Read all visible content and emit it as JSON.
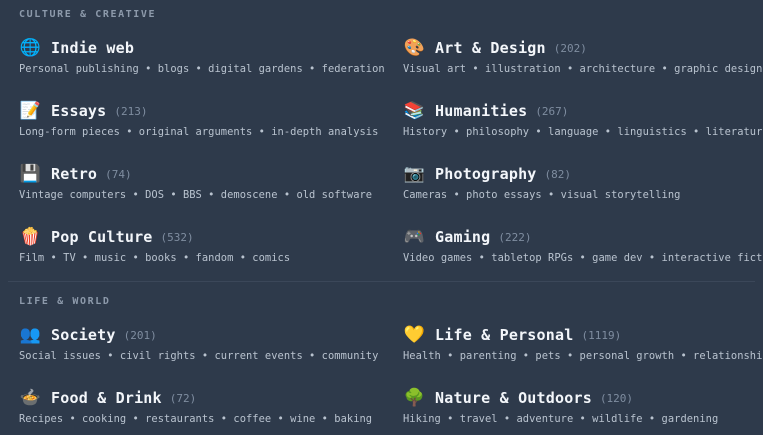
{
  "sections": [
    {
      "title": "CULTURE & CREATIVE",
      "items": [
        {
          "icon": "globe-icon",
          "glyph": "🌐",
          "name": "Indie web",
          "count": "",
          "desc": "Personal publishing • blogs • digital gardens • federation"
        },
        {
          "icon": "palette-icon",
          "glyph": "🎨",
          "name": "Art & Design",
          "count": "(202)",
          "desc": "Visual art • illustration • architecture • graphic design"
        },
        {
          "icon": "memo-icon",
          "glyph": "📝",
          "name": "Essays",
          "count": "(213)",
          "desc": "Long-form pieces • original arguments • in-depth analysis"
        },
        {
          "icon": "books-icon",
          "glyph": "📚",
          "name": "Humanities",
          "count": "(267)",
          "desc": "History • philosophy • language • linguistics • literature"
        },
        {
          "icon": "floppy-disk-icon",
          "glyph": "💾",
          "name": "Retro",
          "count": "(74)",
          "desc": "Vintage computers • DOS • BBS • demoscene • old software"
        },
        {
          "icon": "camera-icon",
          "glyph": "📷",
          "name": "Photography",
          "count": "(82)",
          "desc": "Cameras • photo essays • visual storytelling"
        },
        {
          "icon": "popcorn-icon",
          "glyph": "🍿",
          "name": "Pop Culture",
          "count": "(532)",
          "desc": "Film • TV • music • books • fandom • comics"
        },
        {
          "icon": "gamepad-icon",
          "glyph": "🎮",
          "name": "Gaming",
          "count": "(222)",
          "desc": "Video games • tabletop RPGs • game dev • interactive fiction"
        }
      ]
    },
    {
      "title": "LIFE & WORLD",
      "items": [
        {
          "icon": "people-icon",
          "glyph": "👥",
          "name": "Society",
          "count": "(201)",
          "desc": "Social issues • civil rights • current events • community"
        },
        {
          "icon": "yellow-heart-icon",
          "glyph": "💛",
          "name": "Life & Personal",
          "count": "(1119)",
          "desc": "Health • parenting • pets • personal growth • relationships"
        },
        {
          "icon": "food-bowl-icon",
          "glyph": "🍲",
          "name": "Food & Drink",
          "count": "(72)",
          "desc": "Recipes • cooking • restaurants • coffee • wine • baking"
        },
        {
          "icon": "tree-icon",
          "glyph": "🌳",
          "name": "Nature & Outdoors",
          "count": "(120)",
          "desc": "Hiking • travel • adventure • wildlife • gardening"
        }
      ]
    }
  ]
}
